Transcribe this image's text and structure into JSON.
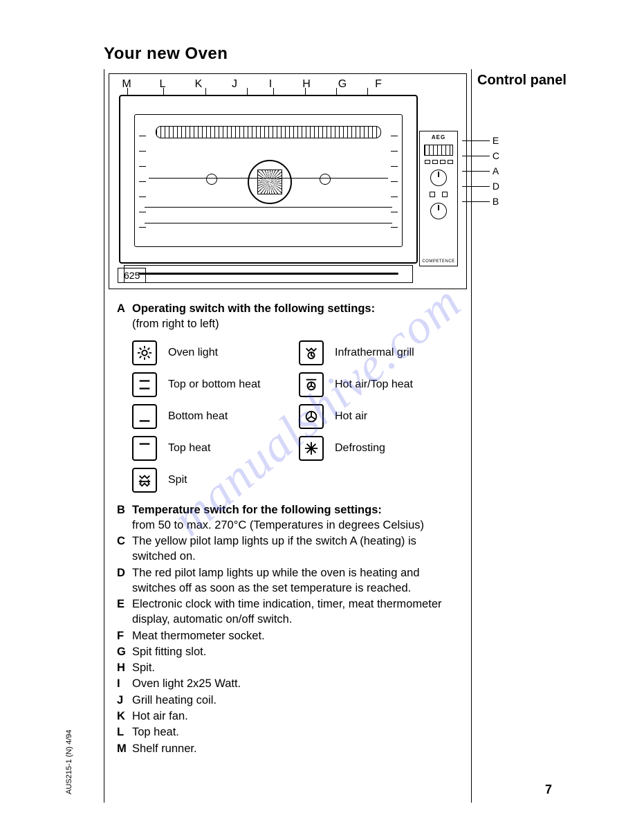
{
  "title": "Your new Oven",
  "side_title": "Control panel",
  "diagram": {
    "top_labels": [
      "M",
      "L",
      "K",
      "J",
      "I",
      "H",
      "G",
      "F"
    ],
    "right_labels": [
      "E",
      "C",
      "A",
      "D",
      "B"
    ],
    "brand": "AEG",
    "subbrand": "COMPETENCE",
    "model": "625"
  },
  "section_a": {
    "letter": "A",
    "heading": "Operating switch with the following settings:",
    "sub": "(from right to left)",
    "settings_left": [
      {
        "icon": "light",
        "label": "Oven light"
      },
      {
        "icon": "topbottom",
        "label": "Top or bottom heat"
      },
      {
        "icon": "bottom",
        "label": "Bottom heat"
      },
      {
        "icon": "top",
        "label": "Top heat"
      },
      {
        "icon": "spit",
        "label": "Spit"
      }
    ],
    "settings_right": [
      {
        "icon": "infragrill",
        "label": "Infrathermal grill"
      },
      {
        "icon": "hotairtop",
        "label": "Hot air/Top heat"
      },
      {
        "icon": "hotair",
        "label": "Hot air"
      },
      {
        "icon": "defrost",
        "label": "Defrosting"
      }
    ]
  },
  "section_b": {
    "letter": "B",
    "heading": "Temperature switch for the following settings:",
    "text": "from 50 to max. 270°C (Temperatures in degrees Celsius)"
  },
  "items": [
    {
      "letter": "C",
      "text": "The yellow pilot lamp lights up if the switch A (heating) is switched on."
    },
    {
      "letter": "D",
      "text": "The red pilot lamp lights up while the oven is heating and switches off as soon as the set temperature is reached."
    },
    {
      "letter": "E",
      "text": "Electronic clock with time indication, timer, meat thermometer display, automatic on/off switch."
    },
    {
      "letter": "F",
      "text": "Meat thermometer socket."
    },
    {
      "letter": "G",
      "text": "Spit fitting slot."
    },
    {
      "letter": "H",
      "text": "Spit."
    },
    {
      "letter": "I",
      "text": "Oven light 2x25 Watt."
    },
    {
      "letter": "J",
      "text": "Grill heating coil."
    },
    {
      "letter": "K",
      "text": "Hot air fan."
    },
    {
      "letter": "L",
      "text": "Top heat."
    },
    {
      "letter": "M",
      "text": "Shelf runner."
    }
  ],
  "watermark": "manualshive.com",
  "docref": "AUS215-1 (N) 4/94",
  "page": "7"
}
